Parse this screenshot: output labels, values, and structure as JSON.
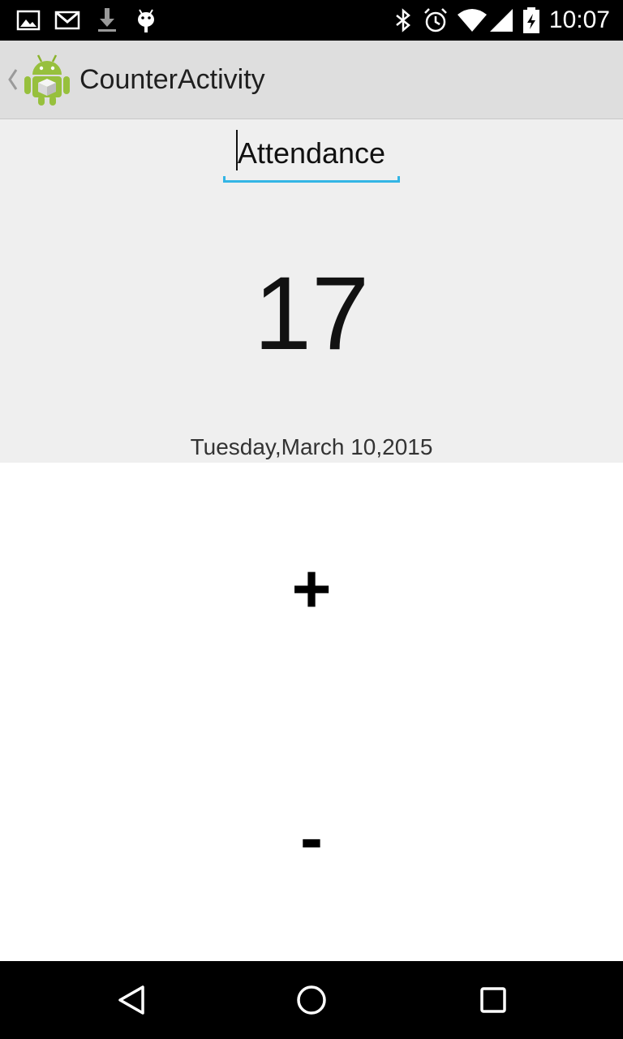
{
  "status_bar": {
    "time": "10:07",
    "left_icons": [
      "image-icon",
      "gmail-icon",
      "download-icon",
      "android-debug-icon"
    ],
    "right_icons": [
      "bluetooth-icon",
      "alarm-icon",
      "wifi-icon",
      "signal-icon",
      "battery-icon"
    ]
  },
  "action_bar": {
    "title": "CounterActivity",
    "icon": "android-app-icon"
  },
  "counter": {
    "name": "Attendance",
    "count": "17",
    "date": "Tuesday,March 10,2015"
  },
  "buttons": {
    "increment_label": "+",
    "decrement_label": "-"
  },
  "nav_bar": {
    "items": [
      "back-icon",
      "home-icon",
      "recents-icon"
    ]
  },
  "colors": {
    "accent": "#33b5e5",
    "status_bar": "#000000",
    "action_bar": "#dedede",
    "content_top": "#efefef",
    "content_bottom": "#ffffff"
  }
}
